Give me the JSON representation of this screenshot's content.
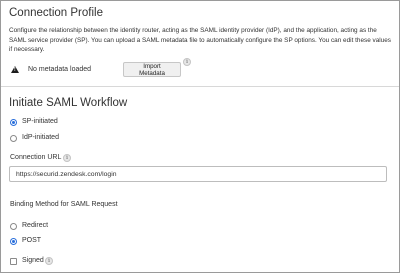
{
  "connection_profile": {
    "title": "Connection Profile",
    "description": "Configure the relationship between the identity router, acting as the SAML identity provider (IdP), and the application, acting as the SAML service provider (SP). You can upload a SAML metadata file to automatically configure the SP options. You can edit these values if necessary.",
    "metadata_status": "No metadata loaded",
    "import_button_label": "Import Metadata",
    "info_glyph": "i",
    "warning_icon": "warning-triangle-icon"
  },
  "saml_workflow": {
    "title": "Initiate SAML Workflow",
    "options": [
      {
        "label": "SP-initiated",
        "selected": true
      },
      {
        "label": "IdP-initiated",
        "selected": false
      }
    ],
    "connection_url_label": "Connection URL",
    "connection_url_value": "https://securid.zendesk.com/login",
    "binding_label": "Binding Method for SAML Request",
    "binding_options": [
      {
        "label": "Redirect",
        "selected": false
      },
      {
        "label": "POST",
        "selected": true
      }
    ],
    "signed_label": "Signed",
    "signed_checked": false
  },
  "colors": {
    "accent": "#2a6fdb",
    "border": "#9a9a9a"
  }
}
